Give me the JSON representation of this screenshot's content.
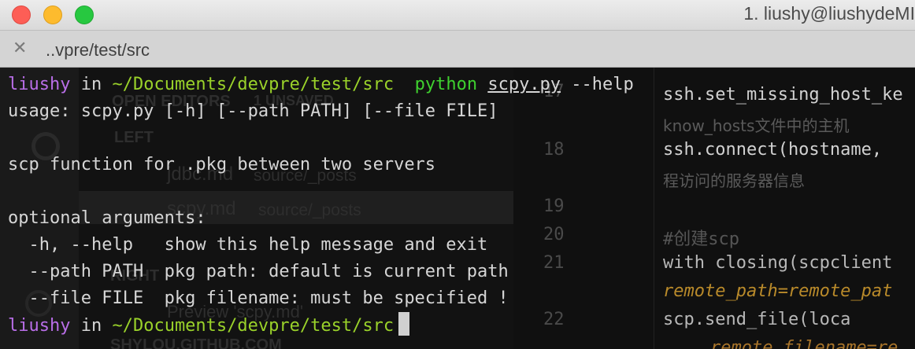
{
  "window": {
    "title": "1. liushy@liushydeMI"
  },
  "tab": {
    "close_glyph": "✕",
    "title": "..vpre/test/src"
  },
  "prompt1": {
    "user": "liushy",
    "in": " in ",
    "path": "~/Documents/devpre/test/src",
    "cmd": "python",
    "script": "scpy.py",
    "args": " --help"
  },
  "output": [
    "usage: scpy.py [-h] [--path PATH] [--file FILE]",
    "",
    "scp function for .pkg between two servers",
    "",
    "optional arguments:",
    "  -h, --help   show this help message and exit",
    "  --path PATH  pkg path: default is current path",
    "  --file FILE  pkg filename: must be specified !"
  ],
  "prompt2": {
    "user": "liushy",
    "in": " in ",
    "path": "~/Documents/devpre/test/src"
  },
  "ghost": {
    "open_editors": "OPEN EDITORS",
    "unsaved": "1 UNSAVED",
    "left": "LEFT",
    "file1": "jdbc.md",
    "file1_dir": "source/_posts",
    "file2": "scpy.md",
    "file2_dir": "source/_posts",
    "right": "RIGHT",
    "preview": "Preview 'scpy.md'",
    "project": "SHYLOU.GITHUB.COM",
    "line_numbers": [
      "17",
      "18",
      "19",
      "20",
      "21",
      "22"
    ],
    "code": [
      "ssh.set_missing_host_ke",
      "know_hosts文件中的主机",
      "ssh.connect(hostname, ",
      "程访问的服务器信息",
      "#创建scp",
      "with closing(scpclient",
      "remote_path=remote_pat",
      "    scp.send_file(loca",
      "remote_filename=re"
    ]
  }
}
